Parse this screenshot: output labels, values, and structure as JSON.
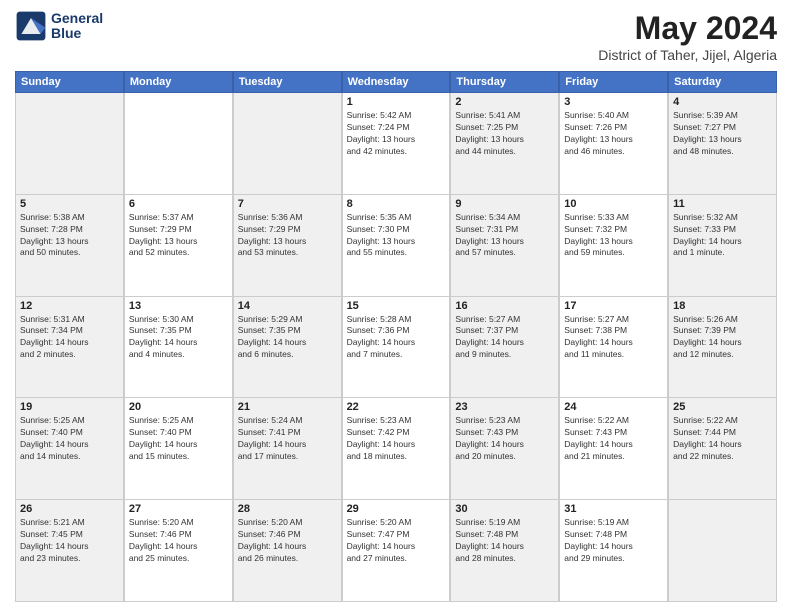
{
  "header": {
    "logo_line1": "General",
    "logo_line2": "Blue",
    "title": "May 2024",
    "subtitle": "District of Taher, Jijel, Algeria"
  },
  "calendar": {
    "days_of_week": [
      "Sunday",
      "Monday",
      "Tuesday",
      "Wednesday",
      "Thursday",
      "Friday",
      "Saturday"
    ],
    "weeks": [
      [
        {
          "day": "",
          "info": ""
        },
        {
          "day": "",
          "info": ""
        },
        {
          "day": "",
          "info": ""
        },
        {
          "day": "1",
          "info": "Sunrise: 5:42 AM\nSunset: 7:24 PM\nDaylight: 13 hours\nand 42 minutes."
        },
        {
          "day": "2",
          "info": "Sunrise: 5:41 AM\nSunset: 7:25 PM\nDaylight: 13 hours\nand 44 minutes."
        },
        {
          "day": "3",
          "info": "Sunrise: 5:40 AM\nSunset: 7:26 PM\nDaylight: 13 hours\nand 46 minutes."
        },
        {
          "day": "4",
          "info": "Sunrise: 5:39 AM\nSunset: 7:27 PM\nDaylight: 13 hours\nand 48 minutes."
        }
      ],
      [
        {
          "day": "5",
          "info": "Sunrise: 5:38 AM\nSunset: 7:28 PM\nDaylight: 13 hours\nand 50 minutes."
        },
        {
          "day": "6",
          "info": "Sunrise: 5:37 AM\nSunset: 7:29 PM\nDaylight: 13 hours\nand 52 minutes."
        },
        {
          "day": "7",
          "info": "Sunrise: 5:36 AM\nSunset: 7:29 PM\nDaylight: 13 hours\nand 53 minutes."
        },
        {
          "day": "8",
          "info": "Sunrise: 5:35 AM\nSunset: 7:30 PM\nDaylight: 13 hours\nand 55 minutes."
        },
        {
          "day": "9",
          "info": "Sunrise: 5:34 AM\nSunset: 7:31 PM\nDaylight: 13 hours\nand 57 minutes."
        },
        {
          "day": "10",
          "info": "Sunrise: 5:33 AM\nSunset: 7:32 PM\nDaylight: 13 hours\nand 59 minutes."
        },
        {
          "day": "11",
          "info": "Sunrise: 5:32 AM\nSunset: 7:33 PM\nDaylight: 14 hours\nand 1 minute."
        }
      ],
      [
        {
          "day": "12",
          "info": "Sunrise: 5:31 AM\nSunset: 7:34 PM\nDaylight: 14 hours\nand 2 minutes."
        },
        {
          "day": "13",
          "info": "Sunrise: 5:30 AM\nSunset: 7:35 PM\nDaylight: 14 hours\nand 4 minutes."
        },
        {
          "day": "14",
          "info": "Sunrise: 5:29 AM\nSunset: 7:35 PM\nDaylight: 14 hours\nand 6 minutes."
        },
        {
          "day": "15",
          "info": "Sunrise: 5:28 AM\nSunset: 7:36 PM\nDaylight: 14 hours\nand 7 minutes."
        },
        {
          "day": "16",
          "info": "Sunrise: 5:27 AM\nSunset: 7:37 PM\nDaylight: 14 hours\nand 9 minutes."
        },
        {
          "day": "17",
          "info": "Sunrise: 5:27 AM\nSunset: 7:38 PM\nDaylight: 14 hours\nand 11 minutes."
        },
        {
          "day": "18",
          "info": "Sunrise: 5:26 AM\nSunset: 7:39 PM\nDaylight: 14 hours\nand 12 minutes."
        }
      ],
      [
        {
          "day": "19",
          "info": "Sunrise: 5:25 AM\nSunset: 7:40 PM\nDaylight: 14 hours\nand 14 minutes."
        },
        {
          "day": "20",
          "info": "Sunrise: 5:25 AM\nSunset: 7:40 PM\nDaylight: 14 hours\nand 15 minutes."
        },
        {
          "day": "21",
          "info": "Sunrise: 5:24 AM\nSunset: 7:41 PM\nDaylight: 14 hours\nand 17 minutes."
        },
        {
          "day": "22",
          "info": "Sunrise: 5:23 AM\nSunset: 7:42 PM\nDaylight: 14 hours\nand 18 minutes."
        },
        {
          "day": "23",
          "info": "Sunrise: 5:23 AM\nSunset: 7:43 PM\nDaylight: 14 hours\nand 20 minutes."
        },
        {
          "day": "24",
          "info": "Sunrise: 5:22 AM\nSunset: 7:43 PM\nDaylight: 14 hours\nand 21 minutes."
        },
        {
          "day": "25",
          "info": "Sunrise: 5:22 AM\nSunset: 7:44 PM\nDaylight: 14 hours\nand 22 minutes."
        }
      ],
      [
        {
          "day": "26",
          "info": "Sunrise: 5:21 AM\nSunset: 7:45 PM\nDaylight: 14 hours\nand 23 minutes."
        },
        {
          "day": "27",
          "info": "Sunrise: 5:20 AM\nSunset: 7:46 PM\nDaylight: 14 hours\nand 25 minutes."
        },
        {
          "day": "28",
          "info": "Sunrise: 5:20 AM\nSunset: 7:46 PM\nDaylight: 14 hours\nand 26 minutes."
        },
        {
          "day": "29",
          "info": "Sunrise: 5:20 AM\nSunset: 7:47 PM\nDaylight: 14 hours\nand 27 minutes."
        },
        {
          "day": "30",
          "info": "Sunrise: 5:19 AM\nSunset: 7:48 PM\nDaylight: 14 hours\nand 28 minutes."
        },
        {
          "day": "31",
          "info": "Sunrise: 5:19 AM\nSunset: 7:48 PM\nDaylight: 14 hours\nand 29 minutes."
        },
        {
          "day": "",
          "info": ""
        }
      ]
    ]
  }
}
